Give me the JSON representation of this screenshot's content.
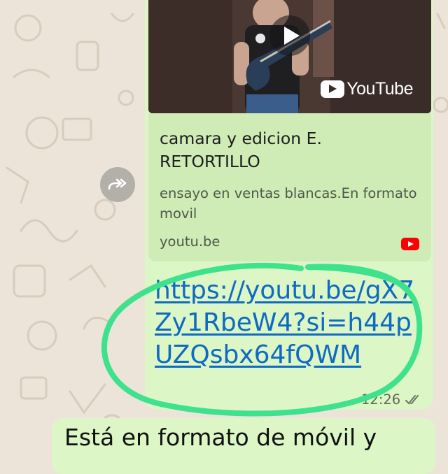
{
  "colors": {
    "bubble_out": "#dcf6c6",
    "preview_card": "#cfecb6",
    "link": "#0e6ac2",
    "annotation": "#3ee28c",
    "youtube_red": "#ff0000"
  },
  "message": {
    "video_brand": "YouTube",
    "preview": {
      "title": "camara y edicion E. RETORTILLO",
      "description": "ensayo en ventas blancas.En formato movil",
      "domain": "youtu.be"
    },
    "link_url": "https://youtu.be/gX7Zy1RbeW4?si=h44pUZQsbx64fQWM",
    "time": "12:26",
    "status_icon": "double-check-icon"
  },
  "next_message": {
    "text": "Está en formato de móvil y"
  },
  "icons": {
    "play": "play-icon",
    "forward": "forward-icon",
    "youtube": "youtube-icon"
  }
}
